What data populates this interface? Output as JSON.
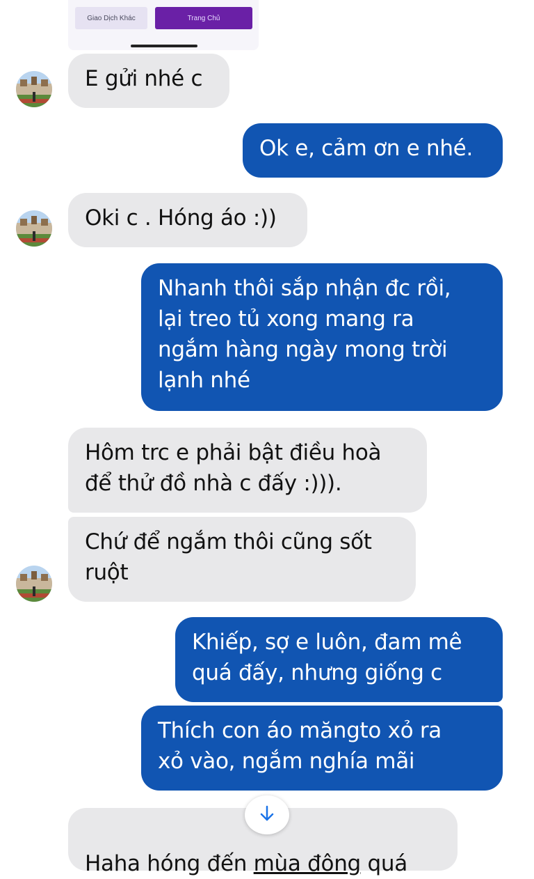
{
  "shared_card": {
    "other_transaction_label": "Giao Dịch Khác",
    "home_label": "Trang Chủ"
  },
  "messages": [
    {
      "sender": "them",
      "text": "E gửi nhé c"
    },
    {
      "sender": "me",
      "text": "Ok e, cảm ơn e nhé."
    },
    {
      "sender": "them",
      "text": "Oki c . Hóng áo :))"
    },
    {
      "sender": "me",
      "text": "Nhanh thôi sắp nhận đc rồi,\nlại treo tủ xong mang ra\nngắm hàng ngày mong trời\nlạnh nhé"
    },
    {
      "sender": "them",
      "text": "Hôm trc e phải bật điều hoà\nđể thử đồ nhà c đấy :)))."
    },
    {
      "sender": "them",
      "text": "Chứ để ngắm thôi cũng sốt\nruột"
    },
    {
      "sender": "me",
      "text": "Khiếp, sợ e luôn, đam mê\nquá đấy, nhưng giống c"
    },
    {
      "sender": "me",
      "text": "Thích con áo măngto xỏ ra\nxỏ vào, ngắm nghía mãi"
    },
    {
      "sender": "them",
      "text_before": "Haha hóng đến ",
      "text_underlined": "mùa đông",
      "text_after": " quá"
    }
  ],
  "icons": {
    "scroll_down": "arrow-down-icon",
    "avatar": "avatar-stadium-image"
  },
  "colors": {
    "outgoing_bubble": "#1155b2",
    "incoming_bubble": "#e8e8ea",
    "home_button": "#6a20a6",
    "scroll_arrow": "#1a73e8"
  }
}
